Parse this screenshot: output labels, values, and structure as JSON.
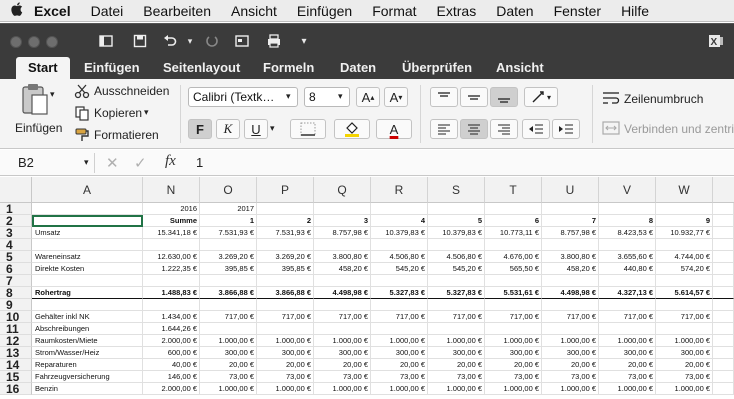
{
  "menubar": {
    "app": "Excel",
    "items": [
      "Datei",
      "Bearbeiten",
      "Ansicht",
      "Einfügen",
      "Format",
      "Extras",
      "Daten",
      "Fenster",
      "Hilfe"
    ]
  },
  "tabs": [
    "Start",
    "Einfügen",
    "Seitenlayout",
    "Formeln",
    "Daten",
    "Überprüfen",
    "Ansicht"
  ],
  "ribbon": {
    "paste_label": "Einfügen",
    "cut_label": "Ausschneiden",
    "copy_label": "Kopieren",
    "format_painter_label": "Formatieren",
    "font_name": "Calibri (Textk…",
    "font_size": "8",
    "bold": "F",
    "italic": "K",
    "underline": "U",
    "font_color_letter": "A",
    "wrap_text": "Zeilenumbruch",
    "merge_center": "Verbinden und zentrie"
  },
  "formula_bar": {
    "name_box": "B2",
    "fx": "fx",
    "value": "1"
  },
  "sheet": {
    "columns": [
      "A",
      "N",
      "O",
      "P",
      "Q",
      "R",
      "S",
      "T",
      "U",
      "V",
      "W"
    ],
    "row_numbers": [
      "1",
      "2",
      "3",
      "4",
      "5",
      "6",
      "7",
      "8",
      "9",
      "10",
      "11",
      "12",
      "13",
      "14",
      "15",
      "16"
    ],
    "rows": [
      [
        "",
        "2016",
        "2017",
        "",
        "",
        "",
        "",
        "",
        "",
        "",
        ""
      ],
      [
        "",
        "Summe",
        "1",
        "2",
        "3",
        "4",
        "5",
        "6",
        "7",
        "8",
        "9"
      ],
      [
        "Umsatz",
        "15.341,18 €",
        "7.531,93 €",
        "7.531,93 €",
        "8.757,98 €",
        "10.379,83 €",
        "10.379,83 €",
        "10.773,11 €",
        "8.757,98 €",
        "8.423,53 €",
        "10.932,77 €"
      ],
      [
        "",
        "",
        "",
        "",
        "",
        "",
        "",
        "",
        "",
        "",
        ""
      ],
      [
        "Wareneinsatz",
        "12.630,00 €",
        "3.269,20 €",
        "3.269,20 €",
        "3.800,80 €",
        "4.506,80 €",
        "4.506,80 €",
        "4.676,00 €",
        "3.800,80 €",
        "3.655,60 €",
        "4.744,00 €"
      ],
      [
        "Direkte Kosten",
        "1.222,35 €",
        "395,85 €",
        "395,85 €",
        "458,20 €",
        "545,20 €",
        "545,20 €",
        "565,50 €",
        "458,20 €",
        "440,80 €",
        "574,20 €"
      ],
      [
        "",
        "",
        "",
        "",
        "",
        "",
        "",
        "",
        "",
        "",
        ""
      ],
      [
        "Rohertrag",
        "1.488,83 €",
        "3.866,88 €",
        "3.866,88 €",
        "4.498,98 €",
        "5.327,83 €",
        "5.327,83 €",
        "5.531,61 €",
        "4.498,98 €",
        "4.327,13 €",
        "5.614,57 €"
      ],
      [
        "",
        "",
        "",
        "",
        "",
        "",
        "",
        "",
        "",
        "",
        ""
      ],
      [
        "Gehälter inkl NK",
        "1.434,00 €",
        "717,00 €",
        "717,00 €",
        "717,00 €",
        "717,00 €",
        "717,00 €",
        "717,00 €",
        "717,00 €",
        "717,00 €",
        "717,00 €"
      ],
      [
        "Abschreibungen",
        "1.644,26 €",
        "",
        "",
        "",
        "",
        "",
        "",
        "",
        "",
        ""
      ],
      [
        "Raumkosten/Miete",
        "2.000,00 €",
        "1.000,00 €",
        "1.000,00 €",
        "1.000,00 €",
        "1.000,00 €",
        "1.000,00 €",
        "1.000,00 €",
        "1.000,00 €",
        "1.000,00 €",
        "1.000,00 €"
      ],
      [
        "Strom/Wasser/Heiz",
        "600,00 €",
        "300,00 €",
        "300,00 €",
        "300,00 €",
        "300,00 €",
        "300,00 €",
        "300,00 €",
        "300,00 €",
        "300,00 €",
        "300,00 €"
      ],
      [
        "Reparaturen",
        "40,00 €",
        "20,00 €",
        "20,00 €",
        "20,00 €",
        "20,00 €",
        "20,00 €",
        "20,00 €",
        "20,00 €",
        "20,00 €",
        "20,00 €"
      ],
      [
        "Fahrzeugversicherung",
        "146,00 €",
        "73,00 €",
        "73,00 €",
        "73,00 €",
        "73,00 €",
        "73,00 €",
        "73,00 €",
        "73,00 €",
        "73,00 €",
        "73,00 €"
      ],
      [
        "Benzin",
        "2.000,00 €",
        "1.000,00 €",
        "1.000,00 €",
        "1.000,00 €",
        "1.000,00 €",
        "1.000,00 €",
        "1.000,00 €",
        "1.000,00 €",
        "1.000,00 €",
        "1.000,00 €"
      ]
    ]
  },
  "colors": {
    "titlebar": "#3b3b3b",
    "ribbon_bg": "#f4f4f4",
    "selection": "#217346"
  }
}
